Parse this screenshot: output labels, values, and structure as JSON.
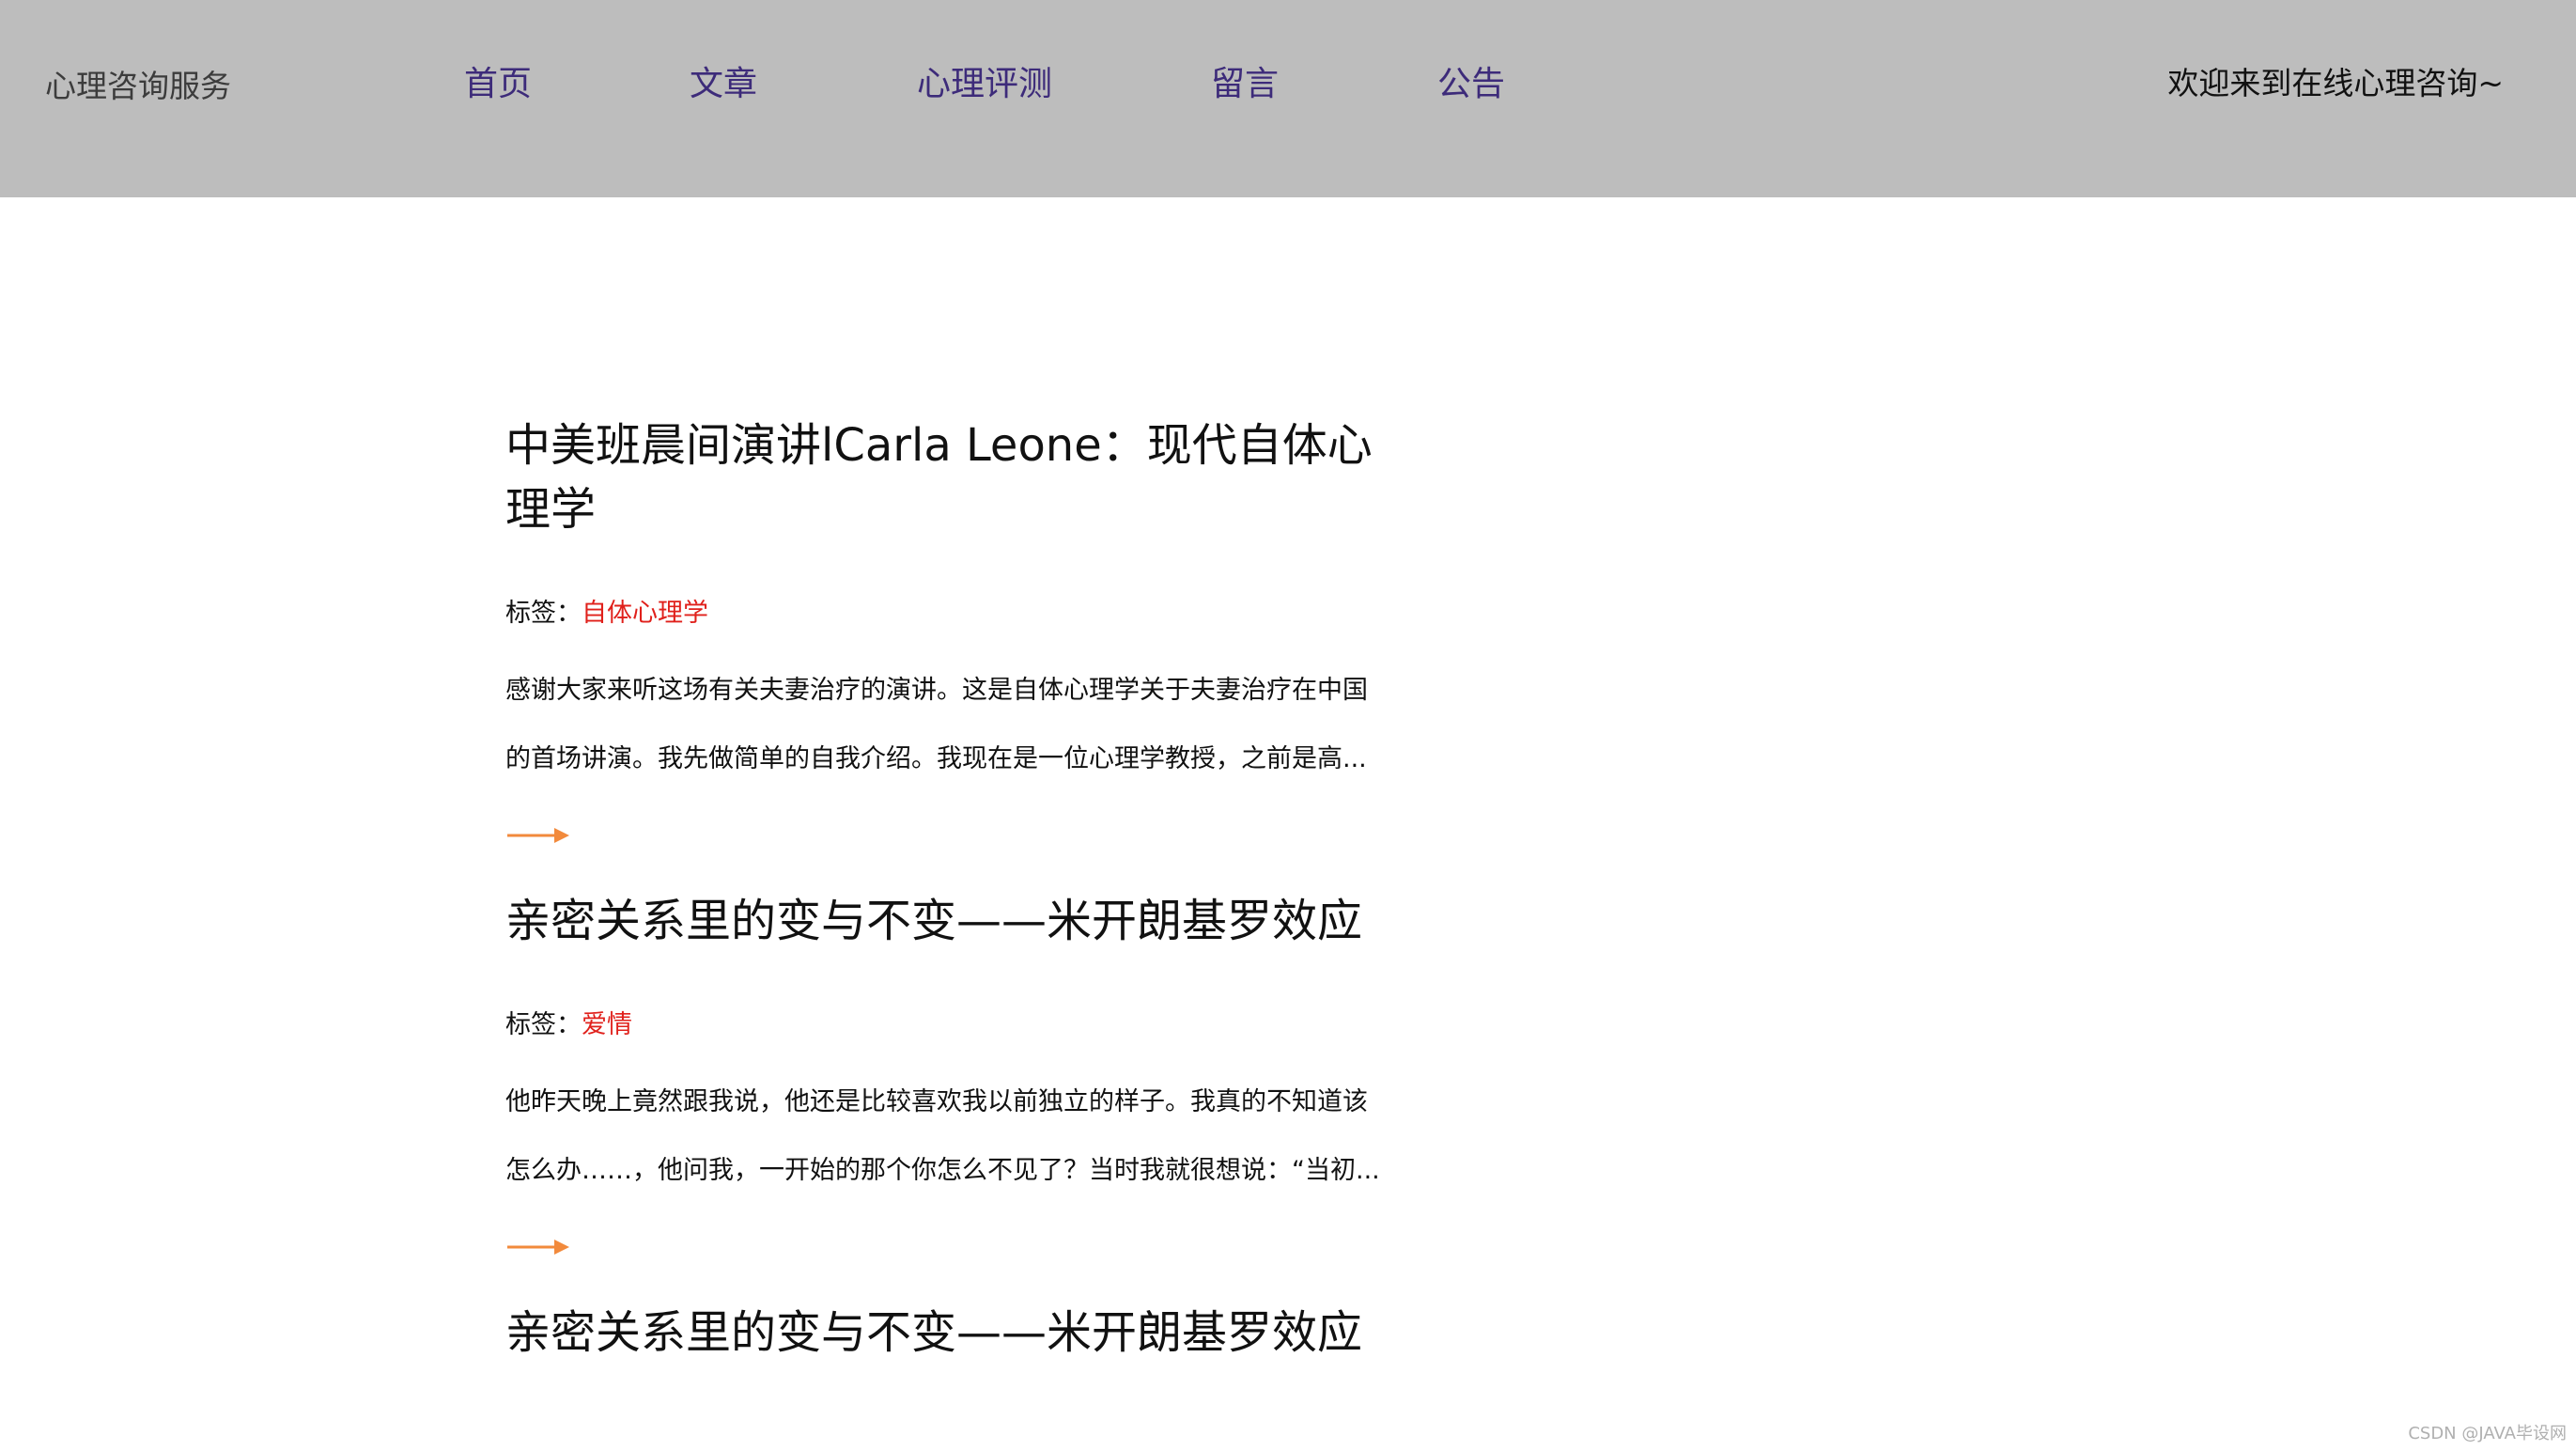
{
  "header": {
    "site_title": "心理咨询服务",
    "nav": [
      {
        "label": "首页"
      },
      {
        "label": "文章"
      },
      {
        "label": "心理评测"
      },
      {
        "label": "留言"
      },
      {
        "label": "公告"
      }
    ],
    "welcome": "欢迎来到在线心理咨询~"
  },
  "articles": [
    {
      "title": "中美班晨间演讲lCarla Leone：现代自体心理学",
      "tag_label": "标签：",
      "tag": "自体心理学",
      "summary_line1": "感谢大家来听这场有关夫妻治疗的演讲。这是自体心理学关于夫妻治疗在中国",
      "summary_line2": "的首场讲演。我先做简单的自我介绍。我现在是一位心理学教授，之前是高..."
    },
    {
      "title": "亲密关系里的变与不变——米开朗基罗效应",
      "tag_label": "标签：",
      "tag": "爱情",
      "summary_line1": "他昨天晚上竟然跟我说，他还是比较喜欢我以前独立的样子。我真的不知道该",
      "summary_line2": "怎么办……，他问我，一开始的那个你怎么不见了？当时我就很想说：“当初..."
    },
    {
      "title": "亲密关系里的变与不变——米开朗基罗效应"
    }
  ],
  "icons": {
    "more_arrow": "arrow-right-icon"
  },
  "colors": {
    "header_bg": "#bdbdbd",
    "nav_text": "#3d2b7a",
    "tag_text": "#e0201b",
    "arrow": "#f28a3c"
  },
  "watermark": "CSDN @JAVA毕设网"
}
